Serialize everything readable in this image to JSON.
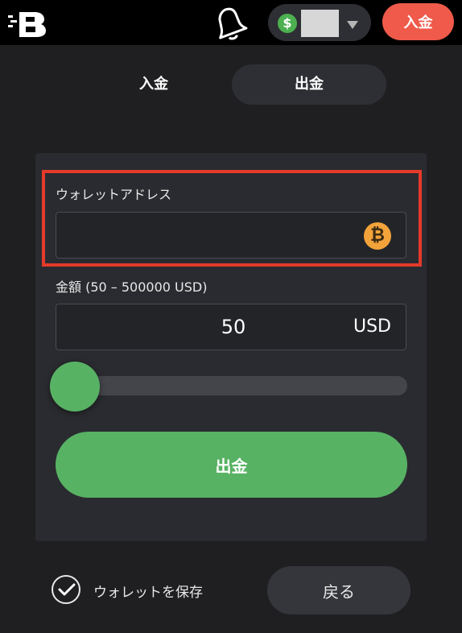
{
  "header": {
    "logo_icon": "logo-b-icon",
    "bell_icon": "bell-icon",
    "balance": {
      "currency_icon": "dollar-icon",
      "currency_symbol": "$",
      "caret_icon": "chevron-down-icon"
    },
    "deposit_label": "入金"
  },
  "tabs": [
    {
      "label": "入金",
      "active": false
    },
    {
      "label": "出金",
      "active": true
    }
  ],
  "form": {
    "wallet_label": "ウォレットアドレス",
    "wallet_value": "",
    "wallet_icon": "bitcoin-icon",
    "wallet_icon_glyph": "₿",
    "amount_label": "金額 (50 – 500000 USD)",
    "amount_value": "50",
    "amount_currency": "USD",
    "slider_fraction": 0.0,
    "submit_label": "出金"
  },
  "footer": {
    "save_wallet_label": "ウォレットを保存",
    "save_wallet_checked": true,
    "back_label": "戻る"
  },
  "colors": {
    "accent_green": "#58b264",
    "deposit_red": "#ef5a4a",
    "highlight_red": "#e53a2a",
    "bitcoin_orange": "#f2a33a"
  }
}
